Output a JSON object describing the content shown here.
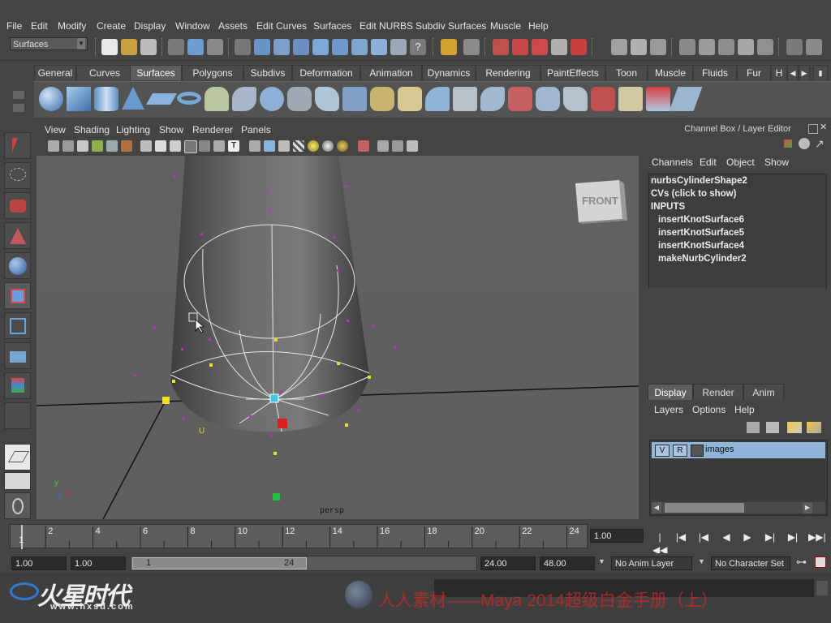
{
  "menubar": [
    "File",
    "Edit",
    "Modify",
    "Create",
    "Display",
    "Window",
    "Assets",
    "Edit Curves",
    "Surfaces",
    "Edit NURBS",
    "Subdiv Surfaces",
    "Muscle",
    "Help"
  ],
  "status": {
    "menu_set": "Surfaces"
  },
  "shelf": {
    "tabs": [
      "General",
      "Curves",
      "Surfaces",
      "Polygons",
      "Subdivs",
      "Deformation",
      "Animation",
      "Dynamics",
      "Rendering",
      "PaintEffects",
      "Toon",
      "Muscle",
      "Fluids",
      "Fur",
      "H"
    ],
    "active_tab": "Surfaces"
  },
  "viewport": {
    "menu": [
      "View",
      "Shading",
      "Lighting",
      "Show",
      "Renderer",
      "Panels"
    ],
    "view_cube_label": "FRONT",
    "camera_label": "persp",
    "axis_labels": {
      "x": "x",
      "y": "y",
      "z": "z"
    },
    "u_label": "U"
  },
  "channel_box": {
    "title": "Channel Box / Layer Editor",
    "menu": [
      "Channels",
      "Edit",
      "Object",
      "Show"
    ],
    "object_name": "nurbsCylinderShape2",
    "cvs_text": "CVs (click to show)",
    "inputs_header": "INPUTS",
    "inputs": [
      "insertKnotSurface6",
      "insertKnotSurface5",
      "insertKnotSurface4",
      "makeNurbCylinder2"
    ]
  },
  "layer_editor": {
    "tabs": [
      "Display",
      "Render",
      "Anim"
    ],
    "active_tab": "Display",
    "menu": [
      "Layers",
      "Options",
      "Help"
    ],
    "layer": {
      "v": "V",
      "r": "R",
      "name": "images"
    }
  },
  "time_slider": {
    "ticks": [
      "2",
      "4",
      "6",
      "8",
      "10",
      "12",
      "14",
      "16",
      "18",
      "20",
      "22",
      "24"
    ],
    "first_frame_label": "1",
    "current_time": "1.00"
  },
  "range_slider": {
    "start_time": "1.00",
    "playback_start": "1.00",
    "range_start_label": "1",
    "range_end_label": "24",
    "playback_end": "24.00",
    "end_time": "48.00",
    "anim_layer": "No Anim Layer",
    "character_set": "No Character Set"
  },
  "watermark": {
    "logo_text": "火星时代",
    "url": "www.hxsd.com",
    "caption": "人人素材——Maya 2014超级白金手册（上）"
  },
  "colors": {
    "bg": "#444444",
    "viewport": "#5e5e5e",
    "accent": "#9bbbd8",
    "layer_row": "#8fb5d8"
  }
}
